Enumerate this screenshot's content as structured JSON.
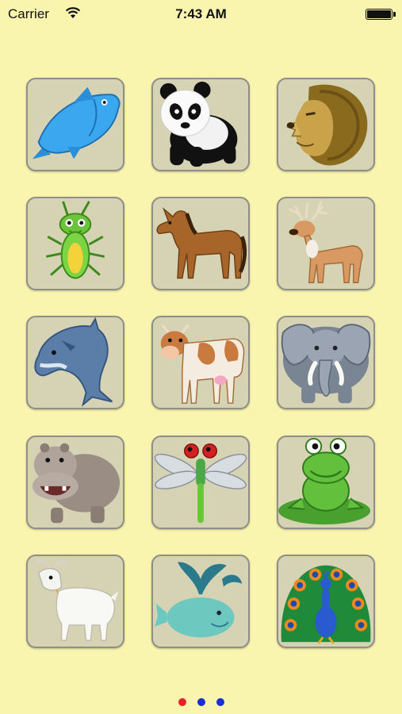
{
  "status_bar": {
    "carrier": "Carrier",
    "time": "7:43 AM"
  },
  "tiles": [
    {
      "icon": "fish-icon"
    },
    {
      "icon": "panda-icon"
    },
    {
      "icon": "lion-icon"
    },
    {
      "icon": "grasshopper-icon"
    },
    {
      "icon": "horse-icon"
    },
    {
      "icon": "deer-icon"
    },
    {
      "icon": "dolphin-icon"
    },
    {
      "icon": "cow-icon"
    },
    {
      "icon": "elephant-icon"
    },
    {
      "icon": "hippo-icon"
    },
    {
      "icon": "dragonfly-icon"
    },
    {
      "icon": "frog-icon"
    },
    {
      "icon": "goat-icon"
    },
    {
      "icon": "whale-icon"
    },
    {
      "icon": "peacock-icon"
    }
  ],
  "page_indicator": {
    "current": 1,
    "total": 3,
    "active_color": "#e8202a",
    "inactive_color": "#1a2fd6"
  }
}
